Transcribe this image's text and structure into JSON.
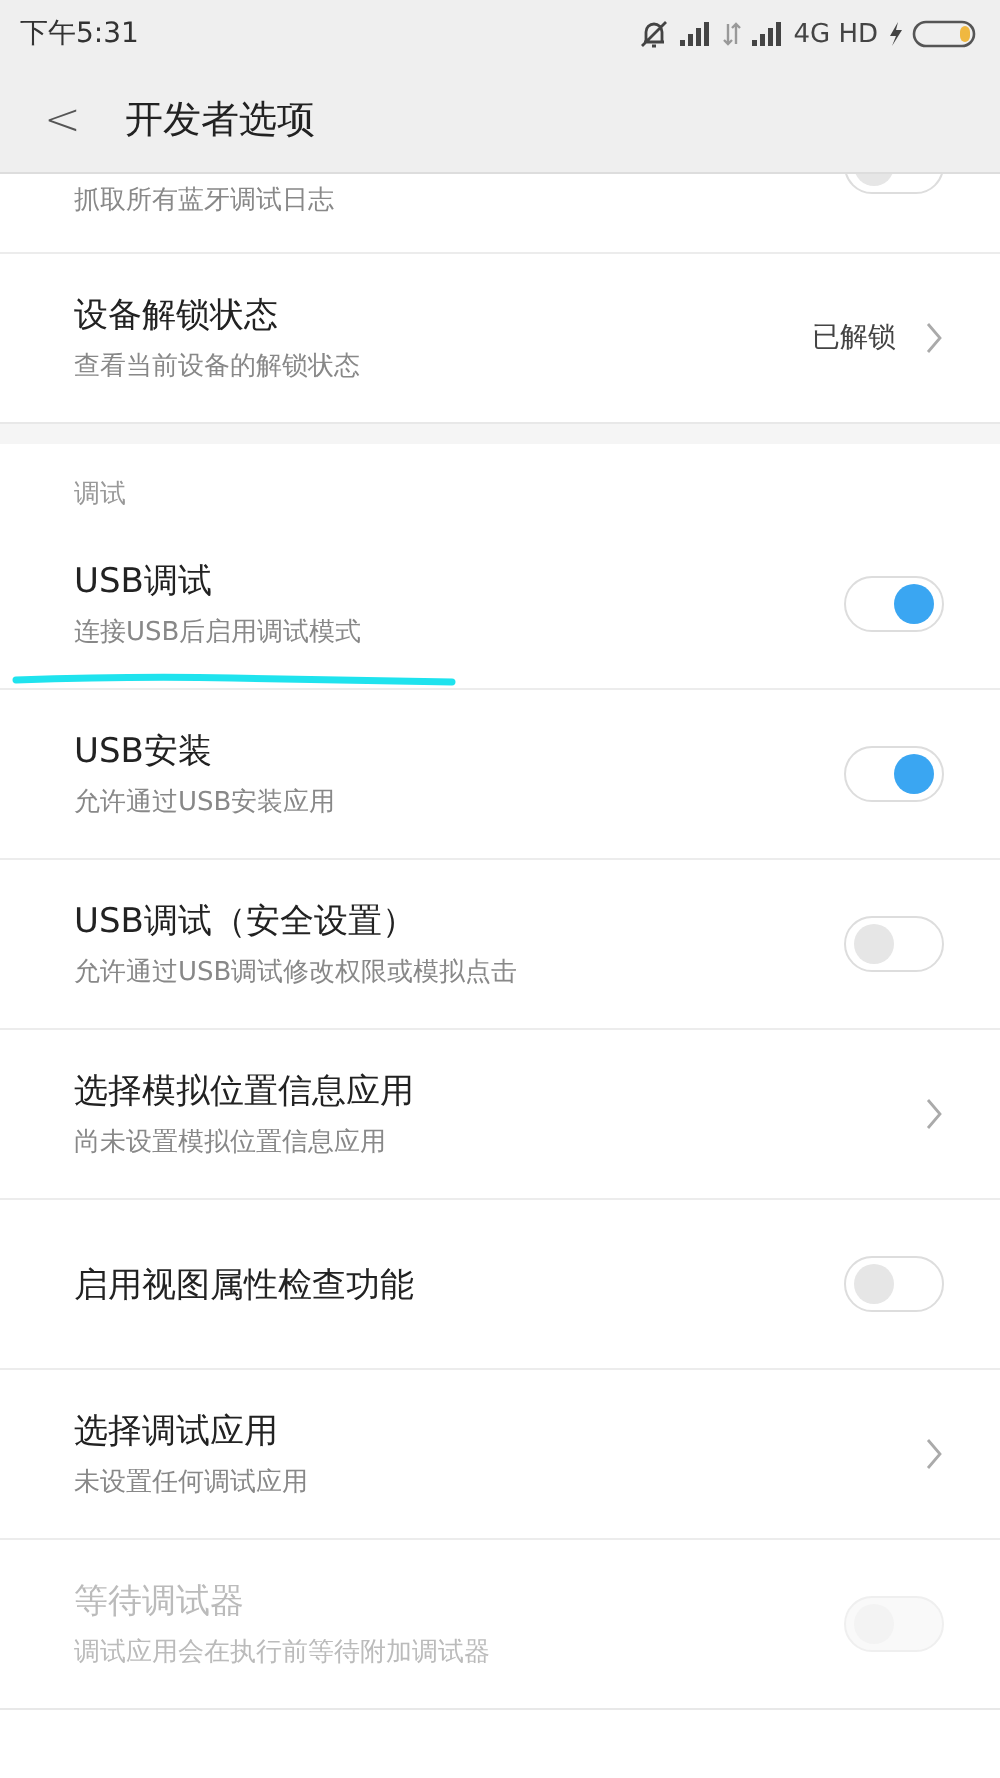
{
  "status_bar": {
    "time": "下午5:31",
    "network": "4G HD"
  },
  "header": {
    "back": "<",
    "title": "开发者选项"
  },
  "sections": [
    {
      "items": [
        {
          "kind": "toggle",
          "subtitle": "抓取所有蓝牙调试日志",
          "on": false,
          "disabled": false,
          "partial": true
        },
        {
          "kind": "value",
          "title": "设备解锁状态",
          "subtitle": "查看当前设备的解锁状态",
          "value": "已解锁"
        }
      ]
    },
    {
      "header": "调试",
      "items": [
        {
          "kind": "toggle",
          "title": "USB调试",
          "subtitle": "连接USB后启用调试模式",
          "on": true,
          "disabled": false,
          "underlined": true
        },
        {
          "kind": "toggle",
          "title": "USB安装",
          "subtitle": "允许通过USB安装应用",
          "on": true,
          "disabled": false
        },
        {
          "kind": "toggle",
          "title": "USB调试（安全设置）",
          "subtitle": "允许通过USB调试修改权限或模拟点击",
          "on": false,
          "disabled": false
        },
        {
          "kind": "link",
          "title": "选择模拟位置信息应用",
          "subtitle": "尚未设置模拟位置信息应用"
        },
        {
          "kind": "toggle",
          "title": "启用视图属性检查功能",
          "on": false,
          "disabled": false
        },
        {
          "kind": "link",
          "title": "选择调试应用",
          "subtitle": "未设置任何调试应用"
        },
        {
          "kind": "toggle",
          "title": "等待调试器",
          "subtitle": "调试应用会在执行前等待附加调试器",
          "on": false,
          "disabled": true
        }
      ]
    }
  ]
}
